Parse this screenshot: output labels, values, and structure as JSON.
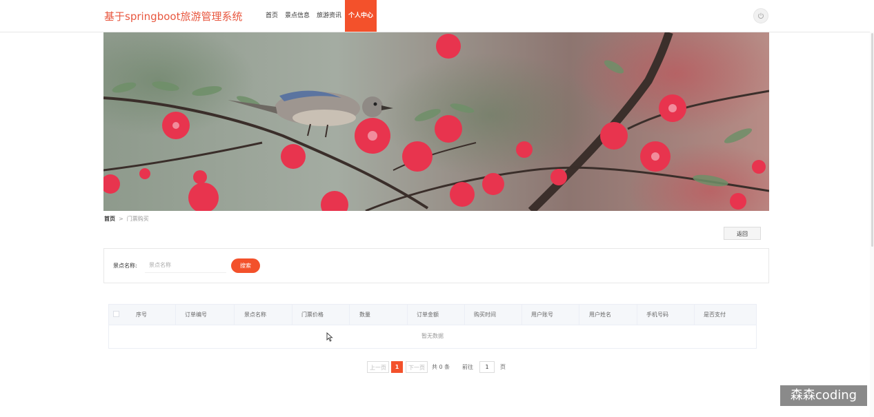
{
  "app": {
    "title": "基于springboot旅游管理系统"
  },
  "nav": {
    "items": [
      {
        "label": "首页"
      },
      {
        "label": "景点信息"
      },
      {
        "label": "旅游资讯"
      },
      {
        "label": "个人中心",
        "active": true
      }
    ]
  },
  "header": {
    "power_icon": "power-icon"
  },
  "breadcrumb": {
    "home": "首页",
    "separator": ">",
    "current": "门票购买"
  },
  "actions": {
    "back_label": "返回"
  },
  "search": {
    "label": "景点名称:",
    "placeholder": "景点名称",
    "button_label": "搜索"
  },
  "table": {
    "columns": [
      "序号",
      "订单编号",
      "景点名称",
      "门票价格",
      "数量",
      "订单金额",
      "购买时间",
      "用户账号",
      "用户姓名",
      "手机号码",
      "是否支付"
    ],
    "rows": [],
    "empty_text": "暂无数据"
  },
  "pagination": {
    "prev": "上一页",
    "current_page": "1",
    "next": "下一页",
    "total": "共 0 条",
    "goto_label": "前往",
    "goto_value": "1",
    "page_suffix": "页"
  },
  "watermark": "森森coding",
  "colors": {
    "accent": "#f3512b",
    "logo": "#e8573f"
  }
}
